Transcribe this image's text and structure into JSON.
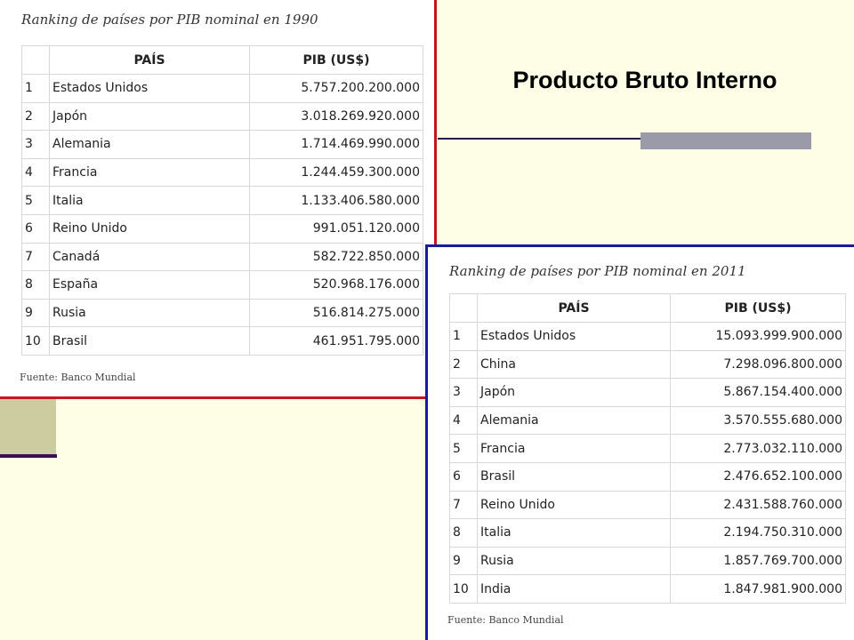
{
  "slide_title": "Producto Bruto Interno",
  "table_1990": {
    "title": "Ranking de países por PIB nominal en 1990",
    "headers": [
      "",
      "PAÍS",
      "PIB (US$)"
    ],
    "rows": [
      {
        "rank": "1",
        "country": "Estados Unidos",
        "gdp": "5.757.200.200.000"
      },
      {
        "rank": "2",
        "country": "Japón",
        "gdp": "3.018.269.920.000"
      },
      {
        "rank": "3",
        "country": "Alemania",
        "gdp": "1.714.469.990.000"
      },
      {
        "rank": "4",
        "country": "Francia",
        "gdp": "1.244.459.300.000"
      },
      {
        "rank": "5",
        "country": "Italia",
        "gdp": "1.133.406.580.000"
      },
      {
        "rank": "6",
        "country": "Reino Unido",
        "gdp": "991.051.120.000"
      },
      {
        "rank": "7",
        "country": "Canadá",
        "gdp": "582.722.850.000"
      },
      {
        "rank": "8",
        "country": "España",
        "gdp": "520.968.176.000"
      },
      {
        "rank": "9",
        "country": "Rusia",
        "gdp": "516.814.275.000"
      },
      {
        "rank": "10",
        "country": "Brasil",
        "gdp": "461.951.795.000"
      }
    ],
    "source": "Fuente: Banco Mundial"
  },
  "table_2011": {
    "title": "Ranking de países por PIB nominal en 2011",
    "headers": [
      "",
      "PAÍS",
      "PIB (US$)"
    ],
    "rows": [
      {
        "rank": "1",
        "country": "Estados Unidos",
        "gdp": "15.093.999.900.000"
      },
      {
        "rank": "2",
        "country": "China",
        "gdp": "7.298.096.800.000"
      },
      {
        "rank": "3",
        "country": "Japón",
        "gdp": "5.867.154.400.000"
      },
      {
        "rank": "4",
        "country": "Alemania",
        "gdp": "3.570.555.680.000"
      },
      {
        "rank": "5",
        "country": "Francia",
        "gdp": "2.773.032.110.000"
      },
      {
        "rank": "6",
        "country": "Brasil",
        "gdp": "2.476.652.100.000"
      },
      {
        "rank": "7",
        "country": "Reino Unido",
        "gdp": "2.431.588.760.000"
      },
      {
        "rank": "8",
        "country": "Italia",
        "gdp": "2.194.750.310.000"
      },
      {
        "rank": "9",
        "country": "Rusia",
        "gdp": "1.857.769.700.000"
      },
      {
        "rank": "10",
        "country": "India",
        "gdp": "1.847.981.900.000"
      }
    ],
    "source": "Fuente: Banco Mundial"
  },
  "colors": {
    "background": "#fefde6",
    "panel_1990_border": "#c8141e",
    "panel_2011_border": "#1a1aa0",
    "accent_square": "#cccca0",
    "accent_line": "#3c1050",
    "title_bar": "#9a9aa8"
  }
}
